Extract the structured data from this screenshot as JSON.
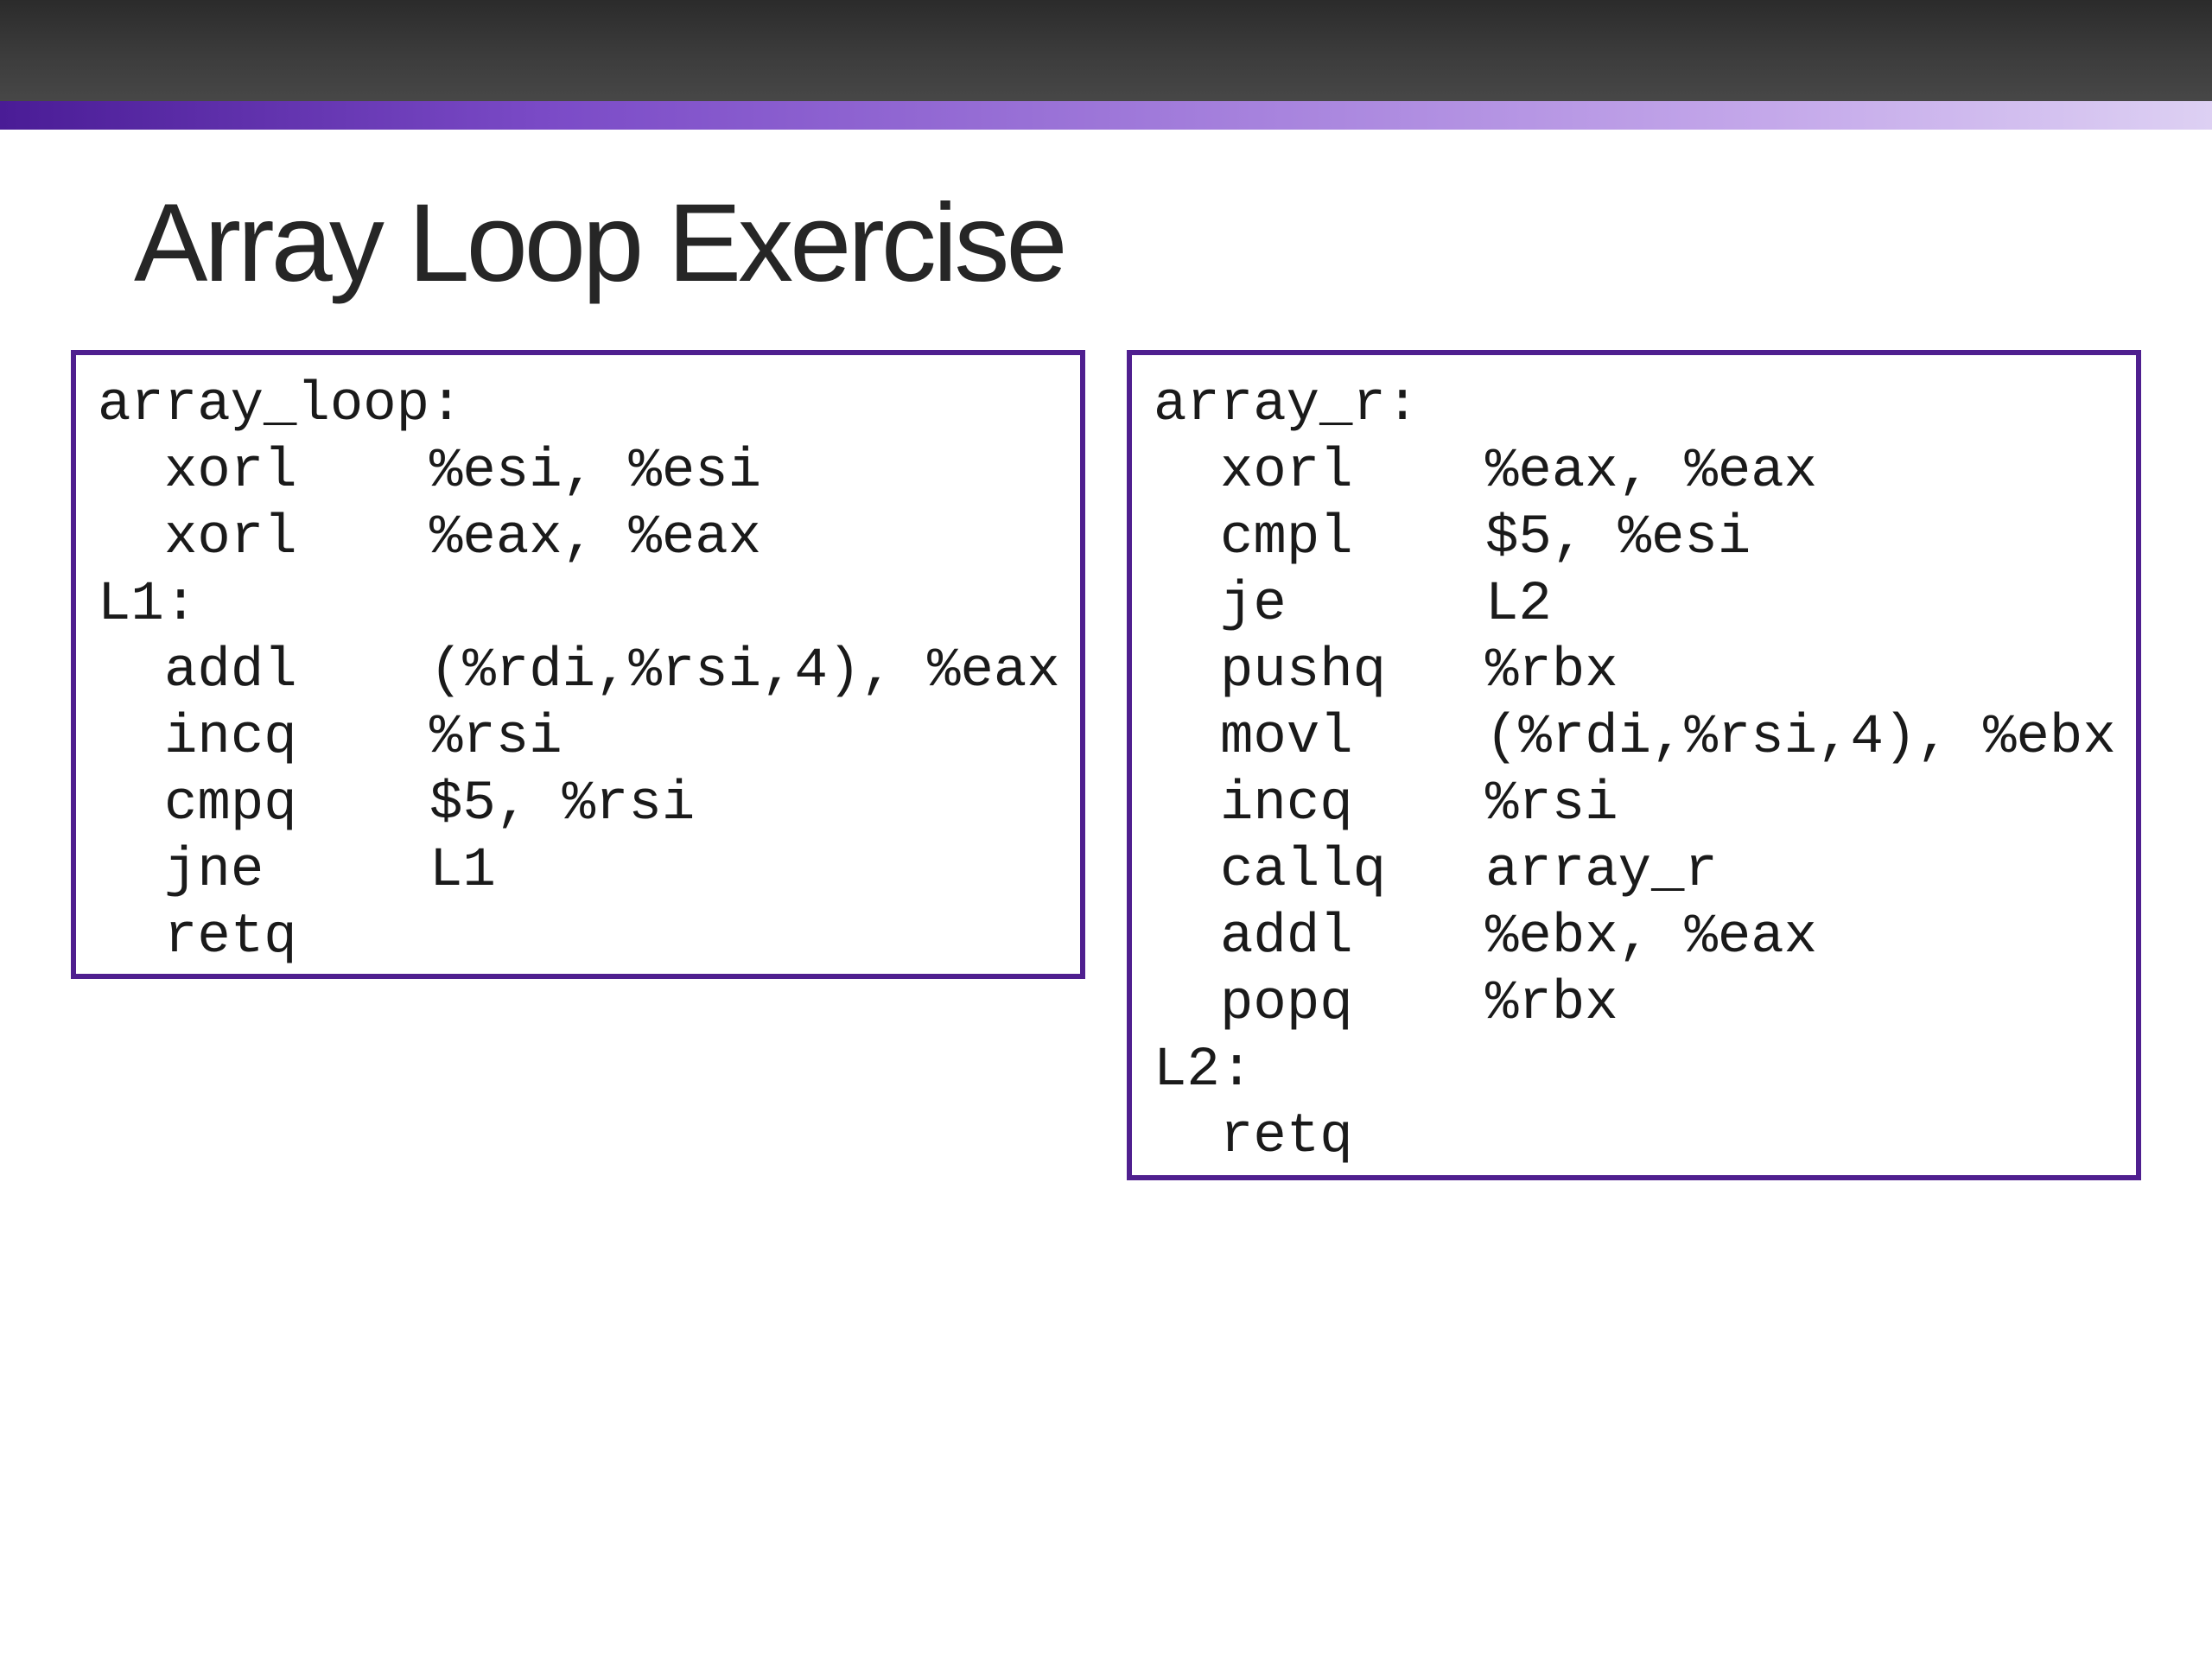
{
  "slide": {
    "title": "Array Loop Exercise"
  },
  "left_box": {
    "label": "array_loop:",
    "instructions_a": [
      {
        "op": "xorl",
        "args": "%esi, %esi"
      },
      {
        "op": "xorl",
        "args": "%eax, %eax"
      }
    ],
    "label2": "L1:",
    "instructions_b": [
      {
        "op": "addl",
        "args": "(%rdi,%rsi,4), %eax"
      },
      {
        "op": "incq",
        "args": "%rsi"
      },
      {
        "op": "cmpq",
        "args": "$5, %rsi"
      },
      {
        "op": "jne",
        "args": "L1"
      },
      {
        "op": "retq",
        "args": ""
      }
    ]
  },
  "right_box": {
    "label": "array_r:",
    "instructions_a": [
      {
        "op": "xorl",
        "args": "%eax, %eax"
      },
      {
        "op": "cmpl",
        "args": "$5, %esi"
      },
      {
        "op": "je",
        "args": "L2"
      },
      {
        "op": "pushq",
        "args": "%rbx"
      },
      {
        "op": "movl",
        "args": "(%rdi,%rsi,4), %ebx"
      },
      {
        "op": "incq",
        "args": "%rsi"
      },
      {
        "op": "callq",
        "args": "array_r"
      },
      {
        "op": "addl",
        "args": "%ebx, %eax"
      },
      {
        "op": "popq",
        "args": "%rbx"
      }
    ],
    "label2": "L2:",
    "instructions_b": [
      {
        "op": "retq",
        "args": ""
      }
    ]
  }
}
